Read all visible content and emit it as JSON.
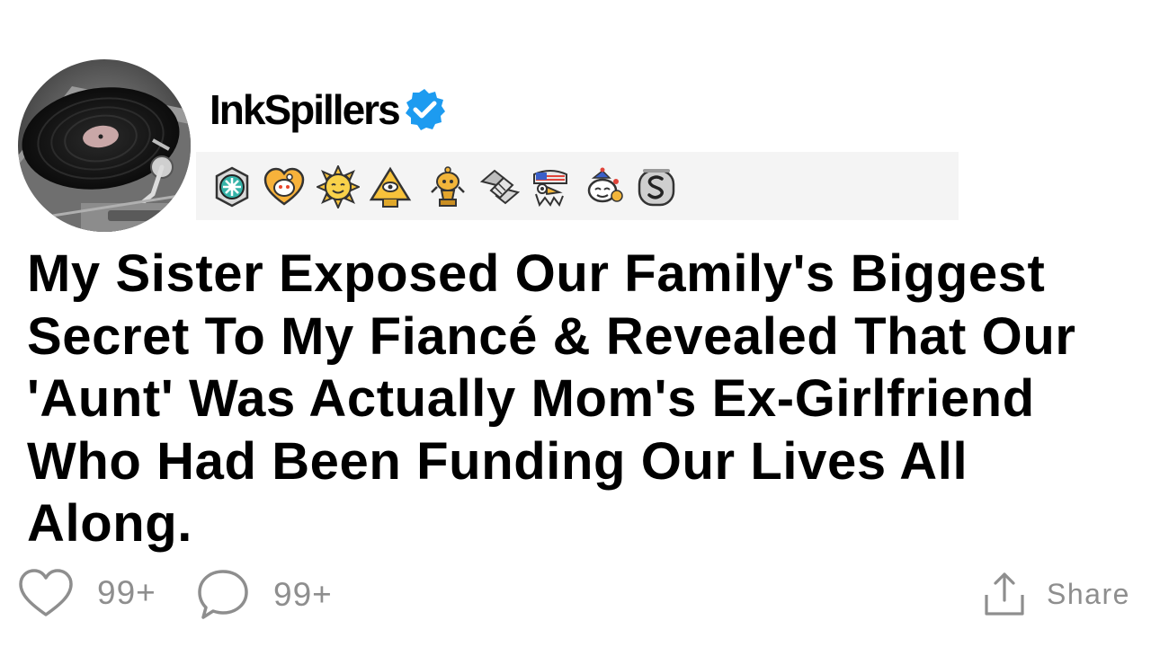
{
  "post": {
    "author": {
      "username": "InkSpillers",
      "verified": true,
      "avatar_icon": "vinyl-turntable-icon"
    },
    "awards": [
      "snoo-badge-award-icon",
      "heart-snoo-award-icon",
      "sun-face-award-icon",
      "pyramid-eye-award-icon",
      "golden-snoo-trophy-award-icon",
      "handshake-award-icon",
      "eagle-flag-award-icon",
      "snoo-wholesome-award-icon",
      "silver-s-award-icon"
    ],
    "title": "My Sister Exposed Our Family's Biggest Secret To My Fiancé & Revealed That Our 'Aunt' Was Actually Mom's Ex-Girlfriend Who Had Been Funding Our Lives All Along.",
    "likes": "99+",
    "comments": "99+",
    "share_label": "Share"
  },
  "colors": {
    "verified_badge": "#1d9bf0",
    "action_gray": "#8e8e8e",
    "awards_background": "#f4f4f4"
  }
}
